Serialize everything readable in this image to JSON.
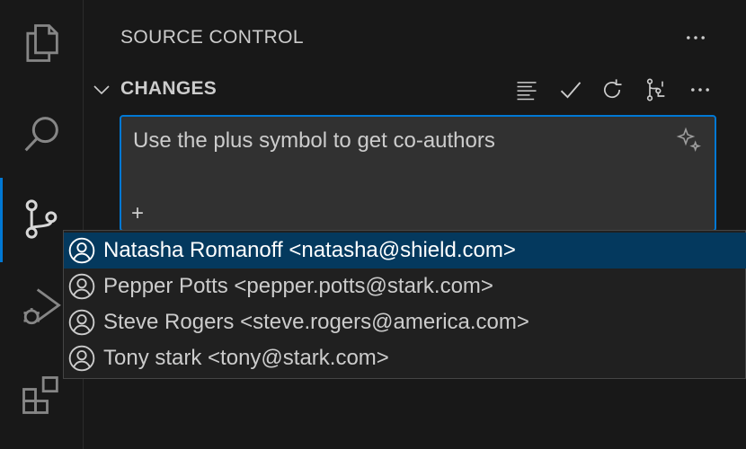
{
  "panel": {
    "title": "SOURCE CONTROL"
  },
  "section": {
    "label": "CHANGES"
  },
  "toolbar": {
    "icons": [
      "list-icon",
      "check-icon",
      "refresh-icon",
      "graph-icon",
      "more-icon"
    ]
  },
  "commit": {
    "message": "Use the plus symbol to get co-authors",
    "trigger": "+"
  },
  "suggestions": [
    {
      "text": "Natasha Romanoff <natasha@shield.com>",
      "selected": true
    },
    {
      "text": "Pepper Potts <pepper.potts@stark.com>",
      "selected": false
    },
    {
      "text": "Steve Rogers <steve.rogers@america.com>",
      "selected": false
    },
    {
      "text": "Tony stark <tony@stark.com>",
      "selected": false
    }
  ],
  "colors": {
    "accent": "#0078d4",
    "selection": "#04395e",
    "background": "#181818",
    "input": "#313131"
  }
}
